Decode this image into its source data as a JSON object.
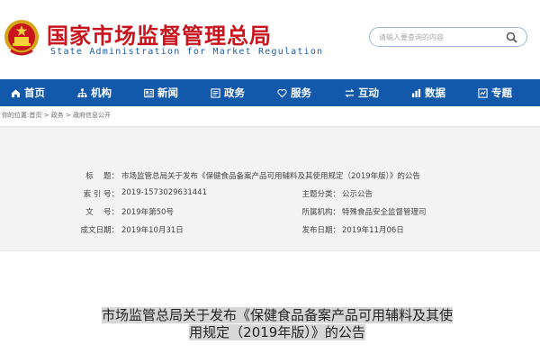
{
  "header": {
    "title": "国家市场监督管理总局",
    "subtitle": "State Administration for Market Regulation",
    "emblem_icon": "national-emblem-icon",
    "search_placeholder": "请输入要查询的内容",
    "search_icon": "search-icon"
  },
  "colors": {
    "brand_red": "#c8141c",
    "nav_blue": "#1259ab",
    "subtitle_blue": "#1e5aa3",
    "panel_gray": "#f3f3f3"
  },
  "nav": {
    "items": [
      {
        "label": "首页",
        "icon": "home-icon"
      },
      {
        "label": "机构",
        "icon": "org-chart-icon"
      },
      {
        "label": "新闻",
        "icon": "news-icon"
      },
      {
        "label": "政务",
        "icon": "government-icon"
      },
      {
        "label": "服务",
        "icon": "heart-icon"
      },
      {
        "label": "互动",
        "icon": "interaction-icon"
      },
      {
        "label": "数据",
        "icon": "chart-icon"
      },
      {
        "label": "专题",
        "icon": "topic-icon"
      }
    ]
  },
  "breadcrumb": {
    "text": "你的位置:首页 > 政务 > 政府信息公开"
  },
  "info": {
    "title_label": "标　 题：",
    "title_value": "市场监管总局关于发布《保健食品备案产品可用辅料及其使用规定（2019年版）》的公告",
    "index_label": "索 引 号：",
    "index_value": "2019-1573029631441",
    "topic_label": "主题分类：",
    "topic_value": "公示公告",
    "docno_label": "文　 号：",
    "docno_value": "2019年第50号",
    "org_label": "所属机构：",
    "org_value": "特殊食品安全监督管理司",
    "created_label": "成文日期：",
    "created_value": "2019年10月31日",
    "published_label": "发布日期：",
    "published_value": "2019年11月06日"
  },
  "article": {
    "title_line1": "市场监管总局关于发布《保健食品备案产品可用辅料及其使",
    "title_line2": "用规定（2019年版）》的公告"
  }
}
